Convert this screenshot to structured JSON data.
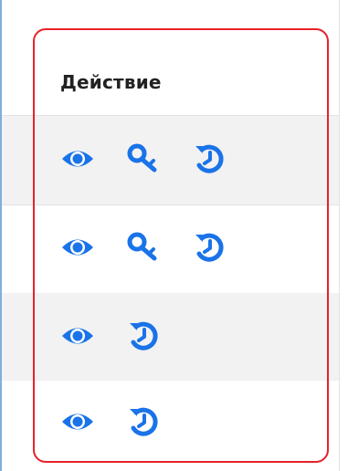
{
  "table": {
    "column_header": "Действие",
    "rows": [
      {
        "actions": [
          "view-icon",
          "key-icon",
          "history-icon"
        ]
      },
      {
        "actions": [
          "view-icon",
          "key-icon",
          "history-icon"
        ]
      },
      {
        "actions": [
          "view-icon",
          "history-icon"
        ]
      },
      {
        "actions": [
          "view-icon",
          "history-icon"
        ]
      }
    ]
  },
  "colors": {
    "icon": "#1a73e8",
    "highlight": "#e8202a",
    "row_alt": "#f2f2f2"
  }
}
